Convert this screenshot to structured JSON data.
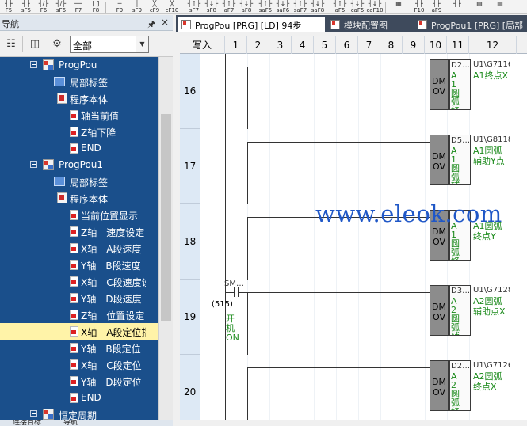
{
  "toolbar": {
    "buttons": [
      {
        "glyph": "┤├",
        "caption": "F5"
      },
      {
        "glyph": "┤├",
        "caption": "sF5"
      },
      {
        "glyph": "┤/├",
        "caption": "F6"
      },
      {
        "glyph": "┤/├",
        "caption": "sF6"
      },
      {
        "glyph": "──",
        "caption": "F7"
      },
      {
        "glyph": "[ ]",
        "caption": "F8"
      },
      {
        "glyph": "─",
        "caption": "F9"
      },
      {
        "glyph": "│",
        "caption": "sF9"
      },
      {
        "glyph": "╳",
        "caption": "cF9"
      },
      {
        "glyph": "╳",
        "caption": "cF10"
      },
      {
        "glyph": "┤↑├",
        "caption": "sF7"
      },
      {
        "glyph": "┤↓├",
        "caption": "sF8"
      },
      {
        "glyph": "┤↑├",
        "caption": "aF7"
      },
      {
        "glyph": "┤↓├",
        "caption": "aF8"
      },
      {
        "glyph": "┤↑├",
        "caption": "saF5"
      },
      {
        "glyph": "┤↓├",
        "caption": "saF6"
      },
      {
        "glyph": "┤↑├",
        "caption": "saF7"
      },
      {
        "glyph": "┤↓├",
        "caption": "saF8"
      },
      {
        "glyph": "┤↑├",
        "caption": "aF5"
      },
      {
        "glyph": "┤↓├",
        "caption": "caF5"
      },
      {
        "glyph": "┤↓├",
        "caption": "caF10"
      },
      {
        "glyph": "▦",
        "caption": ""
      },
      {
        "glyph": "┤├",
        "caption": "F10"
      },
      {
        "glyph": "┤├",
        "caption": "aF9"
      },
      {
        "glyph": "┤├",
        "caption": ""
      },
      {
        "glyph": "▤",
        "caption": ""
      },
      {
        "glyph": "▤",
        "caption": ""
      }
    ]
  },
  "nav": {
    "title": "导航",
    "pin": "p",
    "close": "×",
    "filter_value": "全部",
    "tree": [
      {
        "label": "ProgPou",
        "level": 0,
        "kind": "program",
        "expand": true
      },
      {
        "label": "局部标签",
        "level": 1,
        "kind": "label"
      },
      {
        "label": "程序本体",
        "level": 1,
        "kind": "body"
      },
      {
        "label": "轴当前值",
        "level": 2,
        "kind": "doc"
      },
      {
        "label": "Z轴下降",
        "level": 2,
        "kind": "doc"
      },
      {
        "label": "END",
        "level": 2,
        "kind": "doc"
      },
      {
        "label": "ProgPou1",
        "level": 0,
        "kind": "program",
        "expand": true
      },
      {
        "label": "局部标签",
        "level": 1,
        "kind": "label"
      },
      {
        "label": "程序本体",
        "level": 1,
        "kind": "body"
      },
      {
        "label": "当前位置显示",
        "level": 2,
        "kind": "doc"
      },
      {
        "label": "Z轴　速度设定",
        "level": 2,
        "kind": "doc"
      },
      {
        "label": "X轴　A段速度",
        "level": 2,
        "kind": "doc"
      },
      {
        "label": "Y轴　B段速度",
        "level": 2,
        "kind": "doc"
      },
      {
        "label": "X轴　C段速度设",
        "level": 2,
        "kind": "doc"
      },
      {
        "label": "Y轴　D段速度",
        "level": 2,
        "kind": "doc"
      },
      {
        "label": "Z轴　位置设定",
        "level": 2,
        "kind": "doc"
      },
      {
        "label": "X轴　A段定位指",
        "level": 2,
        "kind": "doc",
        "selected": true
      },
      {
        "label": "Y轴　B段定位",
        "level": 2,
        "kind": "doc"
      },
      {
        "label": "X轴　C段定位",
        "level": 2,
        "kind": "doc"
      },
      {
        "label": "Y轴　D段定位",
        "level": 2,
        "kind": "doc"
      },
      {
        "label": "END",
        "level": 2,
        "kind": "doc"
      },
      {
        "label": "恒定周期",
        "level": 0,
        "kind": "program",
        "expand": false
      }
    ],
    "bottom_tabs": [
      "连接目标",
      "导航"
    ]
  },
  "tabs": [
    {
      "label": "ProgPou [PRG] [LD] 94步",
      "active": true
    },
    {
      "label": "模块配置图",
      "active": false
    },
    {
      "label": "ProgPou1 [PRG] [局部",
      "active": false
    }
  ],
  "ladder": {
    "mode": "写入",
    "columns": [
      "1",
      "2",
      "3",
      "4",
      "5",
      "6",
      "7",
      "8",
      "9",
      "10",
      "11",
      "12"
    ],
    "rungs": [
      {
        "step": "16",
        "dev10": "D2…",
        "cm10": "A1圆弧终…",
        "dev12": "U1\\G7116",
        "cm12": "A1终点X",
        "contact": false
      },
      {
        "step": "17",
        "dev10": "D5…",
        "cm10": "A1圆弧辅…",
        "dev12": "U1\\G8118",
        "cm12": "A1圆弧辅助Y点",
        "contact": false
      },
      {
        "step": "18",
        "dev10": "",
        "cm10": "A1圆弧终…",
        "dev12": "",
        "cm12": "A1圆弧终点Y",
        "contact": false
      },
      {
        "step": "19",
        "dev10": "D3…",
        "cm10": "A2圆弧辅…",
        "dev12": "U1\\G7128",
        "cm12": "A2圆弧辅助点X",
        "contact": true
      },
      {
        "step": "20",
        "dev10": "D2…",
        "cm10": "A2圆弧终…",
        "dev12": "U1\\G7126",
        "cm12": "A2圆弧终点X",
        "contact": false
      }
    ],
    "instruction": "DMOV",
    "contact_device": "SM…",
    "contact_comment": "开机ON",
    "step_ref": "(515)"
  },
  "watermark": "www.eleok.com"
}
